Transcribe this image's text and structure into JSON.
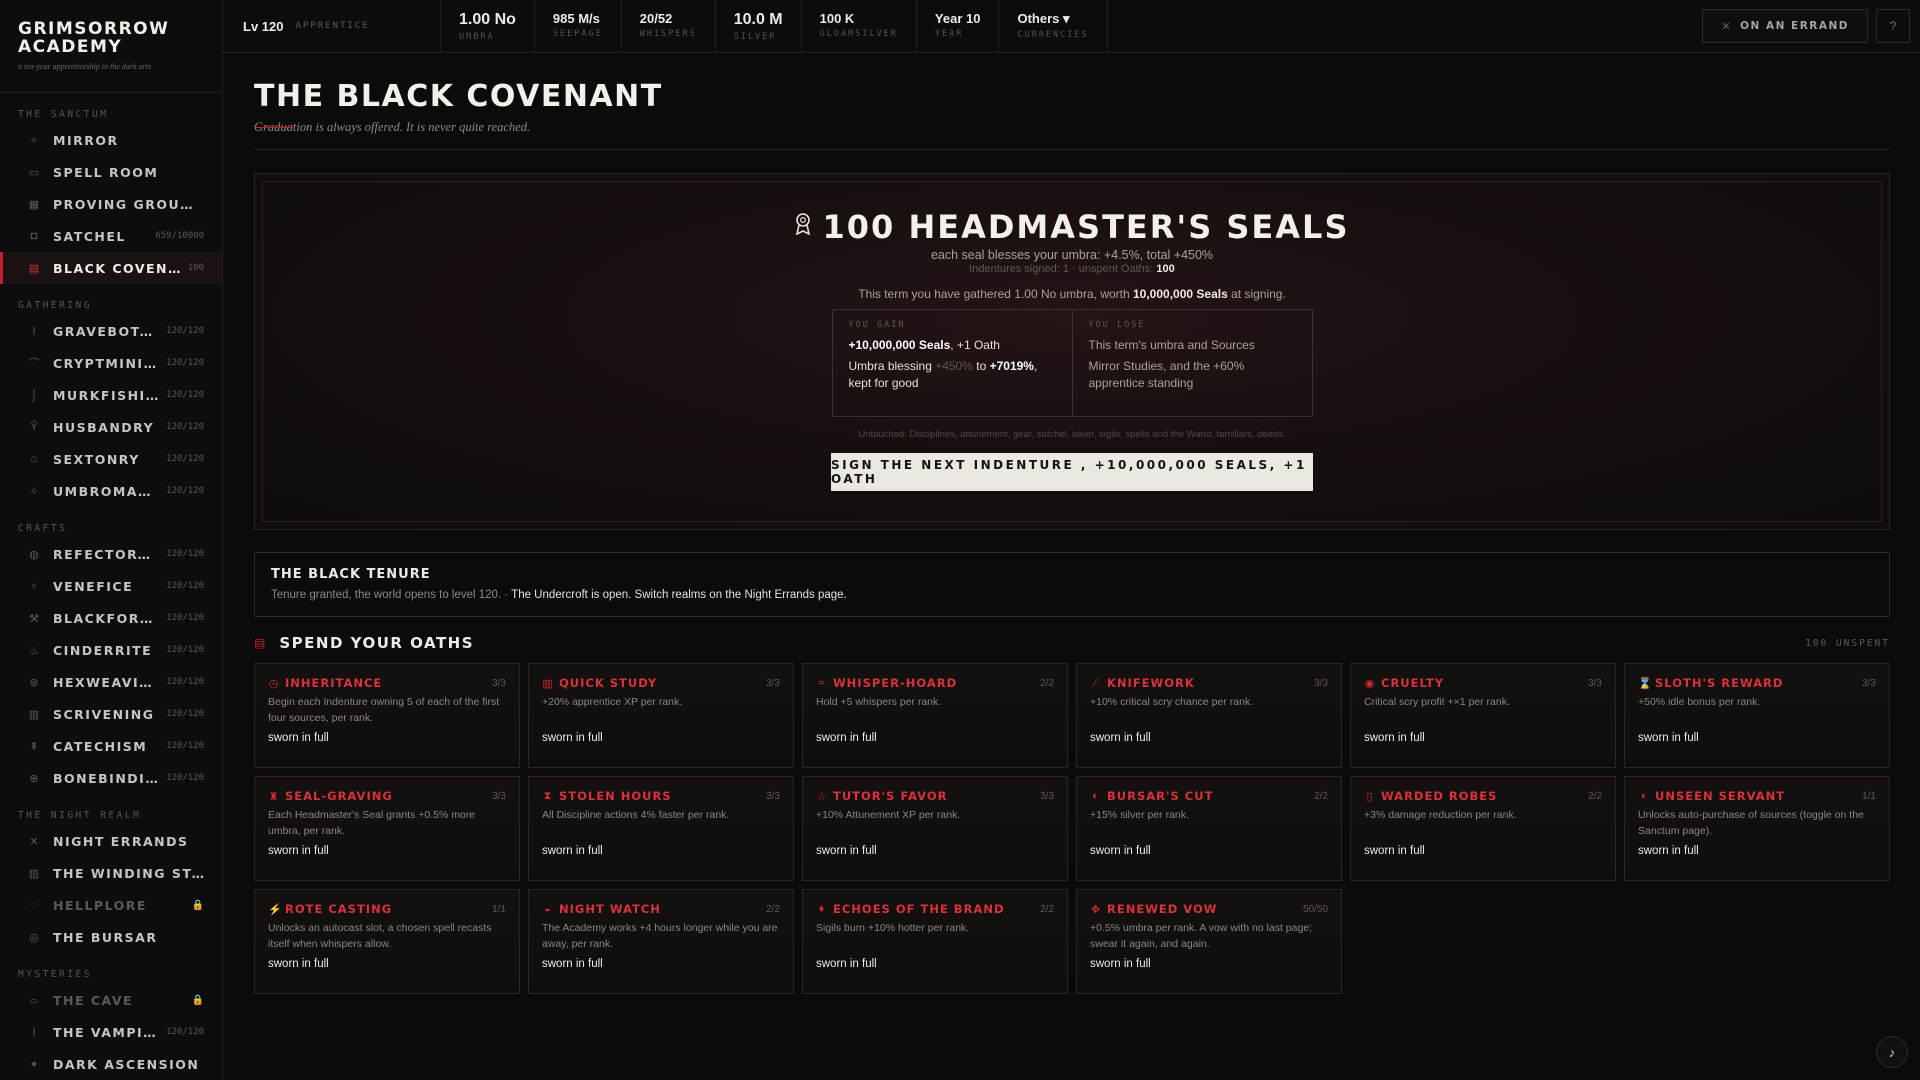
{
  "brand": {
    "title": "GRIMSORROW ACADEMY",
    "tagline": "a ten-year apprenticeship in the dark arts"
  },
  "sidebar": {
    "sections": [
      {
        "heading": "THE SANCTUM",
        "items": [
          {
            "label": "MIRROR",
            "icon": "sparkle-icon",
            "glyph": "✧",
            "count": ""
          },
          {
            "label": "SPELL ROOM",
            "icon": "chat-icon",
            "glyph": "▭",
            "count": ""
          },
          {
            "label": "PROVING GROUNDS",
            "icon": "grid-icon",
            "glyph": "▦",
            "count": ""
          },
          {
            "label": "SATCHEL",
            "icon": "bag-icon",
            "glyph": "◘",
            "count": "659/10000"
          },
          {
            "label": "BLACK COVENANT",
            "icon": "scroll-icon",
            "glyph": "▤",
            "count": "100",
            "active": true
          }
        ]
      },
      {
        "heading": "GATHERING",
        "items": [
          {
            "label": "GRAVEBOTANY",
            "icon": "leaf-icon",
            "glyph": "⌇",
            "count": "120/120"
          },
          {
            "label": "CRYPTMINING",
            "icon": "pickaxe-icon",
            "glyph": "⌒",
            "count": "120/120"
          },
          {
            "label": "MURKFISHING",
            "icon": "hook-icon",
            "glyph": "⌡",
            "count": "120/120"
          },
          {
            "label": "HUSBANDRY",
            "icon": "sprout-icon",
            "glyph": "Ŷ",
            "count": "120/120"
          },
          {
            "label": "SEXTONRY",
            "icon": "tombstone-icon",
            "glyph": "⌂",
            "count": "120/120"
          },
          {
            "label": "UMBROMANCY",
            "icon": "star-icon",
            "glyph": "✧",
            "count": "120/120"
          }
        ]
      },
      {
        "heading": "CRAFTS",
        "items": [
          {
            "label": "REFECTORY KITCHEN",
            "icon": "cauldron-icon",
            "glyph": "◍",
            "count": "120/120"
          },
          {
            "label": "VENEFICE",
            "icon": "flask-icon",
            "glyph": "♁",
            "count": "120/120"
          },
          {
            "label": "BLACKFORGING",
            "icon": "hammer-icon",
            "glyph": "⚒",
            "count": "120/120"
          },
          {
            "label": "CINDERRITE",
            "icon": "flame-icon",
            "glyph": "♨",
            "count": "120/120"
          },
          {
            "label": "HEXWEAVING",
            "icon": "web-icon",
            "glyph": "⊛",
            "count": "120/120"
          },
          {
            "label": "SCRIVENING",
            "icon": "quill-icon",
            "glyph": "▥",
            "count": "120/120"
          },
          {
            "label": "CATECHISM",
            "icon": "candle-icon",
            "glyph": "⇞",
            "count": "120/120"
          },
          {
            "label": "BONEBINDING",
            "icon": "skull-icon",
            "glyph": "⊕",
            "count": "120/120"
          }
        ]
      },
      {
        "heading": "THE NIGHT REALM",
        "items": [
          {
            "label": "NIGHT ERRANDS",
            "icon": "crossed-swords-icon",
            "glyph": "✕",
            "count": ""
          },
          {
            "label": "THE WINDING STAIR",
            "icon": "tower-icon",
            "glyph": "▥",
            "count": ""
          },
          {
            "label": "HELLPLORE",
            "icon": "flame-icon",
            "glyph": "◌",
            "count": "",
            "locked": true
          },
          {
            "label": "THE BURSAR",
            "icon": "coin-icon",
            "glyph": "◎",
            "count": ""
          }
        ]
      },
      {
        "heading": "MYSTERIES",
        "items": [
          {
            "label": "THE CAVE",
            "icon": "cave-icon",
            "glyph": "⌓",
            "count": "",
            "locked": true
          },
          {
            "label": "THE VAMPIRIC COURT",
            "icon": "fang-icon",
            "glyph": "⌇",
            "count": "120/120"
          },
          {
            "label": "DARK ASCENSION",
            "icon": "ascend-icon",
            "glyph": "✦",
            "count": ""
          }
        ]
      }
    ],
    "lock_glyph": "🔒"
  },
  "topbar": {
    "level": "Lv 120",
    "rank": "APPRENTICE",
    "stats": [
      {
        "value": "1.00 No",
        "label": "UMBRA",
        "big": true
      },
      {
        "value": "985 M/s",
        "label": "SEEPAGE"
      },
      {
        "value": "20/52",
        "label": "WHISPERS"
      },
      {
        "value": "10.0 M",
        "label": "SILVER",
        "big": true
      },
      {
        "value": "100 K",
        "label": "GLOAMSILVER"
      },
      {
        "value": "Year 10",
        "label": "YEAR"
      },
      {
        "value": "Others ▾",
        "label": "CURRENCIES"
      }
    ],
    "errand_label": "ON AN ERRAND",
    "help_icon": "?"
  },
  "page": {
    "title": "THE BLACK COVENANT",
    "subtitle_strike": "Gradua",
    "subtitle_rest": "tion is always offered. It is never quite reached."
  },
  "seals": {
    "title": "100 HEADMASTER'S SEALS",
    "description": "each seal blesses your umbra: +4.5%, total +450%",
    "meta_prefix": "Indentures signed: 1 · unspent Oaths: ",
    "meta_value": "100",
    "term_prefix": "This term you have gathered 1.00 No umbra, worth ",
    "term_value": "10,000,000 Seals",
    "term_suffix": " at signing.",
    "gain_head": "YOU GAIN",
    "gain_line1_bold": "+10,000,000 Seals",
    "gain_line1_rest": ", +1 Oath",
    "gain_line2_pre": "Umbra blessing ",
    "gain_line2_old": "+450%",
    "gain_line2_mid": " to ",
    "gain_line2_new": "+7019%",
    "gain_line2_post": ", kept for good",
    "lose_head": "YOU LOSE",
    "lose_line1": "This term's umbra and Sources",
    "lose_line2": "Mirror Studies, and the +60% apprentice standing",
    "untouched": "Untouched: Disciplines, attunement, gear, satchel, silver, sigils, spells and the Wand, familiars, deeds.",
    "sign_button": "SIGN THE NEXT INDENTURE , +10,000,000 SEALS, +1 OATH"
  },
  "tenure": {
    "title": "THE BLACK TENURE",
    "text": "Tenure granted, the world opens to level 120. · ",
    "highlight": "The Undercroft is open. Switch realms on the Night Errands page."
  },
  "oaths": {
    "title": "SPEND YOUR OATHS",
    "unspent": "100 UNSPENT",
    "cards": [
      {
        "name": "INHERITANCE",
        "icon": "gift-icon",
        "glyph": "◷",
        "rank": "3/3",
        "desc": "Begin each Indenture owning 5 of each of the first four sources, per rank.",
        "state": "sworn in full"
      },
      {
        "name": "QUICK STUDY",
        "icon": "book-icon",
        "glyph": "▥",
        "rank": "3/3",
        "desc": "+20% apprentice XP per rank.",
        "state": "sworn in full"
      },
      {
        "name": "WHISPER-HOARD",
        "icon": "wave-icon",
        "glyph": "≈",
        "rank": "2/2",
        "desc": "Hold +5 whispers per rank.",
        "state": "sworn in full"
      },
      {
        "name": "KNIFEWORK",
        "icon": "knife-icon",
        "glyph": "⁄",
        "rank": "3/3",
        "desc": "+10% critical scry chance per rank.",
        "state": "sworn in full"
      },
      {
        "name": "CRUELTY",
        "icon": "eye-icon",
        "glyph": "◉",
        "rank": "3/3",
        "desc": "Critical scry profit +×1 per rank.",
        "state": "sworn in full"
      },
      {
        "name": "SLOTH'S REWARD",
        "icon": "hourglass-icon",
        "glyph": "⌛",
        "rank": "3/3",
        "desc": "+50% idle bonus per rank.",
        "state": "sworn in full"
      },
      {
        "name": "SEAL-GRAVING",
        "icon": "seal-icon",
        "glyph": "♜",
        "rank": "3/3",
        "desc": "Each Headmaster's Seal grants +0.5% more umbra, per rank.",
        "state": "sworn in full"
      },
      {
        "name": "STOLEN HOURS",
        "icon": "hourglass-icon",
        "glyph": "⧗",
        "rank": "3/3",
        "desc": "All Discipline actions 4% faster per rank.",
        "state": "sworn in full"
      },
      {
        "name": "TUTOR'S FAVOR",
        "icon": "star-icon",
        "glyph": "☆",
        "rank": "3/3",
        "desc": "+10% Attunement XP per rank.",
        "state": "sworn in full"
      },
      {
        "name": "BURSAR'S CUT",
        "icon": "coin-icon",
        "glyph": "◐",
        "rank": "2/2",
        "desc": "+15% silver per rank.",
        "state": "sworn in full"
      },
      {
        "name": "WARDED ROBES",
        "icon": "robe-icon",
        "glyph": "▯",
        "rank": "2/2",
        "desc": "+3% damage reduction per rank.",
        "state": "sworn in full"
      },
      {
        "name": "UNSEEN SERVANT",
        "icon": "ghost-icon",
        "glyph": "◗",
        "rank": "1/1",
        "desc": "Unlocks auto-purchase of sources (toggle on the Sanctum page).",
        "state": "sworn in full"
      },
      {
        "name": "ROTE CASTING",
        "icon": "wand-icon",
        "glyph": "⚡",
        "rank": "1/1",
        "desc": "Unlocks an autocast slot, a chosen spell recasts itself when whispers allow.",
        "state": "sworn in full"
      },
      {
        "name": "NIGHT WATCH",
        "icon": "moon-icon",
        "glyph": "◒",
        "rank": "2/2",
        "desc": "The Academy works +4 hours longer while you are away, per rank.",
        "state": "sworn in full"
      },
      {
        "name": "ECHOES OF THE BRAND",
        "icon": "flame-icon",
        "glyph": "♦",
        "rank": "2/2",
        "desc": "Sigils burn +10% hotter per rank.",
        "state": "sworn in full"
      },
      {
        "name": "RENEWED VOW",
        "icon": "vow-icon",
        "glyph": "✥",
        "rank": "50/50",
        "desc": "+0.5% umbra per rank. A vow with no last page; swear it again, and again.",
        "state": "sworn in full"
      }
    ]
  },
  "music": {
    "icon": "♪"
  }
}
